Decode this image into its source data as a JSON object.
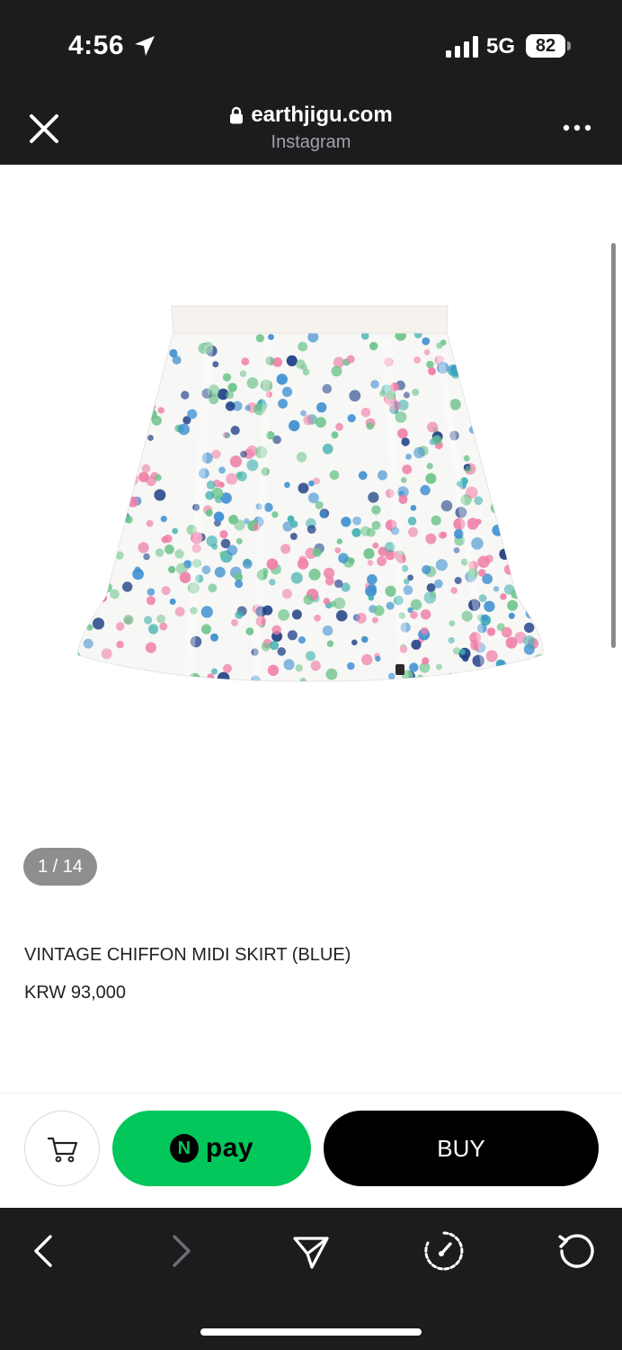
{
  "status_bar": {
    "time": "4:56",
    "network": "5G",
    "battery": "82",
    "icons": [
      "location-arrow-icon",
      "signal-bars-icon"
    ]
  },
  "browser": {
    "url": "earthjigu.com",
    "subtitle": "Instagram",
    "icons": [
      "close-icon",
      "lock-icon",
      "more-icon"
    ]
  },
  "product": {
    "image_counter": "1 / 14",
    "name": "VINTAGE CHIFFON MIDI SKIRT (BLUE)",
    "price": "KRW 93,000"
  },
  "actions": {
    "npay_badge": "N",
    "npay_label": "pay",
    "buy_label": "BUY",
    "icons": [
      "cart-icon"
    ]
  },
  "toolbar": {
    "icons": [
      "back-icon",
      "forward-icon",
      "share-icon",
      "compass-icon",
      "reload-icon"
    ]
  },
  "colors": {
    "dark_bar": "#1c1c1e",
    "npay_green": "#03c75a",
    "buy_black": "#000000",
    "dot_blue": "#3d8fd1",
    "dot_green": "#6cc38a",
    "dot_pink": "#ef7fa8",
    "dot_navy": "#1e3f86",
    "dot_teal": "#3fb0b0"
  }
}
